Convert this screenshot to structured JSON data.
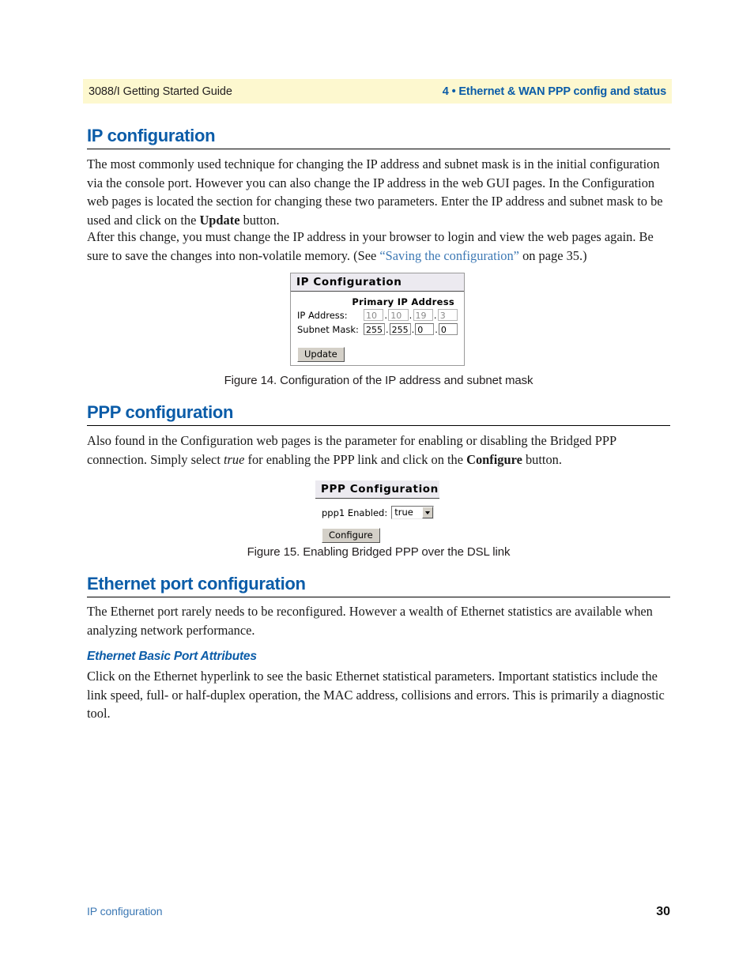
{
  "header": {
    "left": "3088/I Getting Started Guide",
    "right": "4 • Ethernet & WAN PPP config and status"
  },
  "sections": {
    "ip_configuration": {
      "heading": "IP configuration",
      "paragraph1_part1": "The most commonly used technique for changing the IP address and subnet mask is in the initial configuration via the console port. However you can also change the IP address in the web GUI pages. In the Configuration web pages is located the section for changing these two parameters. Enter the IP address and subnet mask to be used and click on the ",
      "paragraph1_bold": "Update",
      "paragraph1_part2": " button.",
      "paragraph2_part1": "After this change, you must change the IP address in your browser to login and view the web pages again. Be sure to save the changes into non-volatile memory. (See ",
      "paragraph2_link": "“Saving the configuration”",
      "paragraph2_part2": " on page 35.)"
    },
    "ppp_configuration": {
      "heading": "PPP configuration",
      "paragraph1_part1": "Also found in the Configuration web pages is the parameter for enabling or disabling the Bridged PPP connection. Simply select ",
      "paragraph1_italic": "true",
      "paragraph1_part2": " for enabling the PPP link and click on the ",
      "paragraph1_bold": "Configure",
      "paragraph1_part3": " button."
    },
    "ethernet_port_configuration": {
      "heading": "Ethernet port configuration",
      "paragraph1": "The Ethernet port rarely needs to be reconfigured. However a wealth of Ethernet statistics are available when analyzing network performance.",
      "subheading": "Ethernet Basic Port Attributes",
      "paragraph2": "Click on the Ethernet hyperlink to see the basic Ethernet statistical parameters. Important statistics include the link speed, full- or half-duplex operation, the MAC address, collisions and errors. This is primarily a diagnostic tool."
    }
  },
  "figure14": {
    "caption": "Figure 14. Configuration of the IP address and subnet mask",
    "dialog": {
      "title": "IP Configuration",
      "column_header": "Primary IP Address",
      "rows": [
        {
          "label": "IP Address:",
          "octets": [
            "10",
            "10",
            "19",
            "3"
          ]
        },
        {
          "label": "Subnet Mask:",
          "octets": [
            "255",
            "255",
            "0",
            "0"
          ]
        }
      ],
      "separator": ".",
      "button": "Update"
    }
  },
  "figure15": {
    "caption": "Figure 15. Enabling Bridged PPP over the DSL link",
    "dialog": {
      "title": "PPP Configuration",
      "field_label": "ppp1 Enabled:",
      "field_value": "true",
      "button": "Configure"
    }
  },
  "footer": {
    "left": "IP configuration",
    "page_number": "30"
  },
  "colors": {
    "heading_blue": "#0b5ca8",
    "link_blue": "#3c78b4",
    "header_band": "#fdf8cf"
  }
}
